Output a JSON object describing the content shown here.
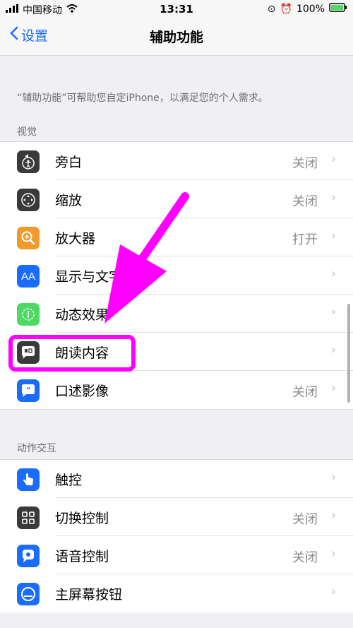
{
  "status": {
    "carrier": "中国移动",
    "time": "13:31",
    "battery": "100%"
  },
  "nav": {
    "back_label": "设置",
    "title": "辅助功能"
  },
  "description": "“辅助功能”可帮助您自定iPhone，以满足您的个人需求。",
  "sections": [
    {
      "header": "视觉",
      "items": [
        {
          "label": "旁白",
          "value": "关闭",
          "icon": "voiceover-icon",
          "color": "#3a3a3c"
        },
        {
          "label": "缩放",
          "value": "关闭",
          "icon": "zoom-icon",
          "color": "#3a3a3c"
        },
        {
          "label": "放大器",
          "value": "打开",
          "icon": "magnifier-icon",
          "color": "#f09a2c"
        },
        {
          "label": "显示与文字",
          "value": "",
          "icon": "display-text-icon",
          "color": "#1a6cff"
        },
        {
          "label": "动态效果",
          "value": "",
          "icon": "motion-icon",
          "color": "#4cd964"
        },
        {
          "label": "朗读内容",
          "value": "",
          "icon": "spoken-content-icon",
          "color": "#3a3a3c"
        },
        {
          "label": "口述影像",
          "value": "关闭",
          "icon": "audio-description-icon",
          "color": "#1a6cff"
        }
      ]
    },
    {
      "header": "动作交互",
      "items": [
        {
          "label": "触控",
          "value": "",
          "icon": "touch-icon",
          "color": "#1a6cff"
        },
        {
          "label": "切换控制",
          "value": "关闭",
          "icon": "switch-control-icon",
          "color": "#3a3a3c"
        },
        {
          "label": "语音控制",
          "value": "关闭",
          "icon": "voice-control-icon",
          "color": "#1a6cff"
        },
        {
          "label": "主屏幕按钮",
          "value": "",
          "icon": "home-button-icon",
          "color": "#1a6cff"
        }
      ]
    }
  ],
  "accent_color": "#ff00ff"
}
